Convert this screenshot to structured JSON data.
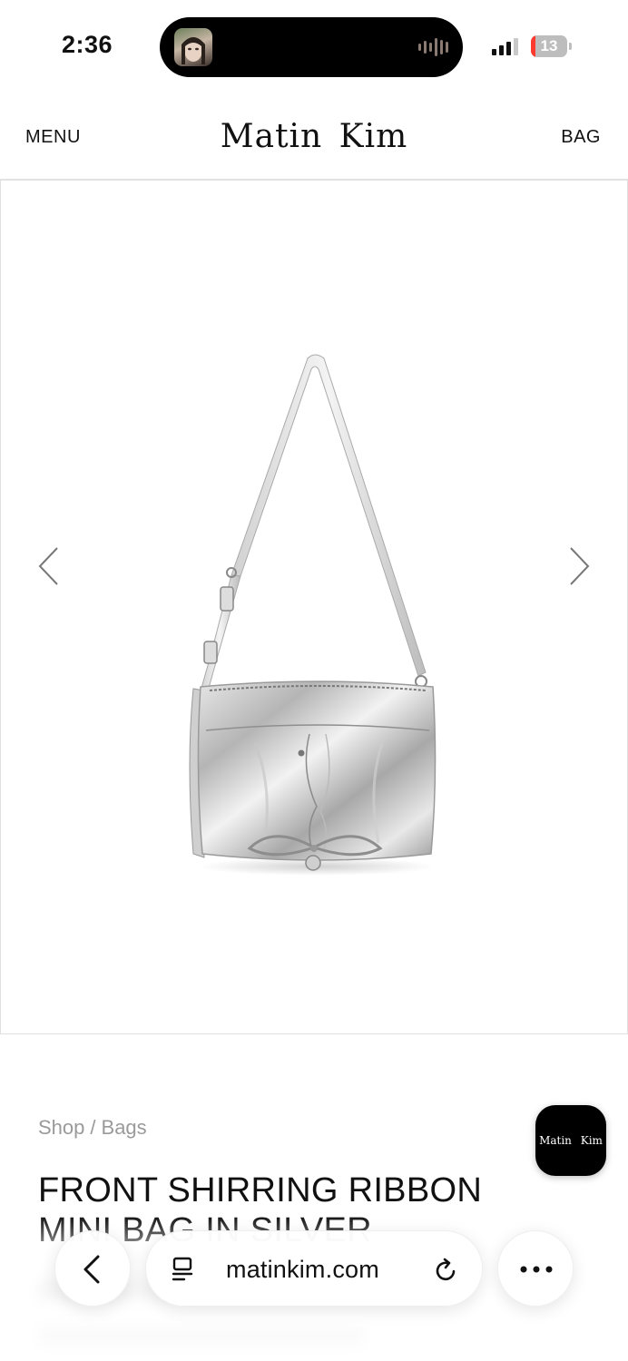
{
  "status_bar": {
    "time": "2:36",
    "battery_level": "13",
    "battery_fraction": 0.13,
    "signal_bars": 3
  },
  "header": {
    "menu_label": "MENU",
    "brand": "Matin Kim",
    "bag_label": "BAG"
  },
  "gallery": {
    "prev_icon": "chevron-left-icon",
    "next_icon": "chevron-right-icon",
    "image": "silver-shoulder-bag"
  },
  "product": {
    "breadcrumb": [
      "Shop",
      "Bags"
    ],
    "breadcrumb_sep": "/",
    "title": "FRONT SHIRRING RIBBON MINI BAG IN SILVER"
  },
  "floating_chip": {
    "label": "Matin Kim"
  },
  "browser": {
    "url": "matinkim.com",
    "back_icon": "chevron-left-icon",
    "reader_icon": "reader-icon",
    "reload_icon": "reload-icon",
    "more_icon": "more-icon"
  },
  "colors": {
    "text": "#111111",
    "muted": "#9a9a9a",
    "battery_low": "#ff3b30"
  }
}
